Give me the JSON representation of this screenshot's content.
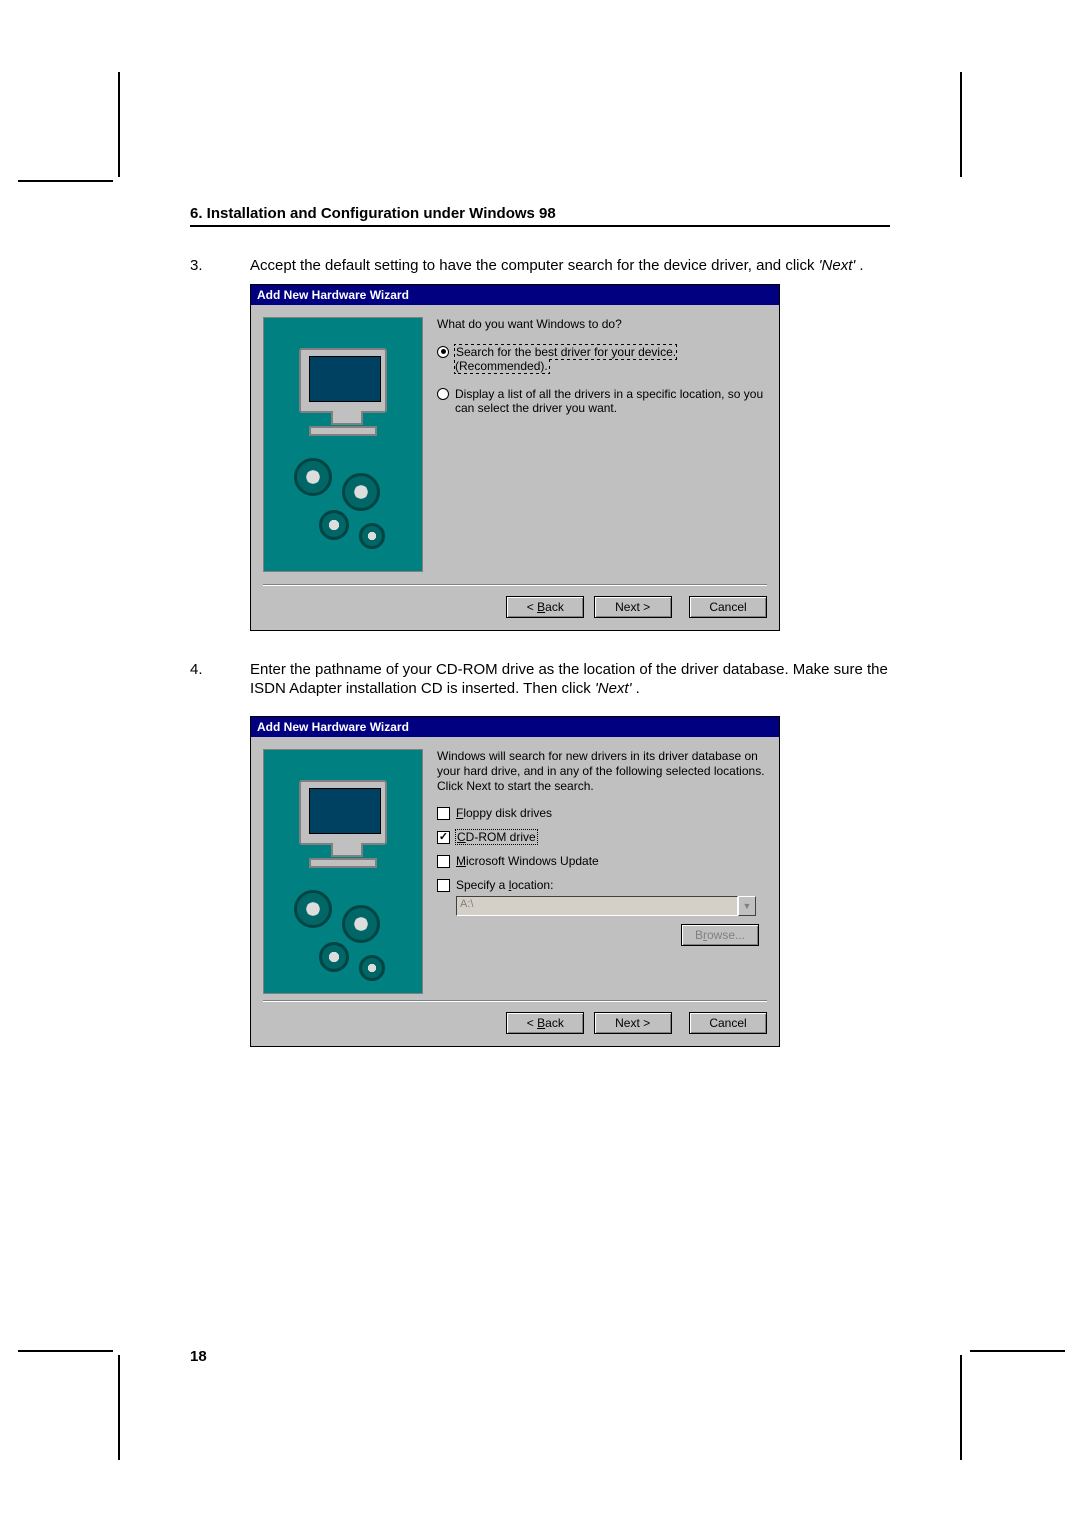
{
  "header": "6. Installation and Configuration under Windows 98",
  "step3": {
    "num": "3.",
    "text_a": "Accept the default setting to have the computer search for the device driver, and click ",
    "text_b": "'Next'",
    "text_c": " ."
  },
  "dialog1": {
    "title": "Add New Hardware Wizard",
    "prompt": "What do you want Windows to do?",
    "opt1": "Search for the best driver for your device. (Recommended).",
    "opt2": "Display a list of all the drivers in a specific location, so you can select the driver you want.",
    "back": "< Back",
    "next": "Next >",
    "cancel": "Cancel"
  },
  "step4": {
    "num": "4.",
    "text_a": "Enter the pathname of your CD-ROM drive as the location of the driver database. Make sure the ISDN Adapter installation CD is inserted. Then click ",
    "text_b": "'Next'",
    "text_c": " ."
  },
  "dialog2": {
    "title": "Add New Hardware Wizard",
    "intro": "Windows will search for new drivers in its driver database on your hard drive, and in any of the following selected locations. Click Next to start the search.",
    "floppy": "Floppy disk drives",
    "cdrom": "CD-ROM drive",
    "update": "Microsoft Windows Update",
    "specify": "Specify a location:",
    "path": "A:\\",
    "browse": "Browse...",
    "back": "< Back",
    "next": "Next >",
    "cancel": "Cancel"
  },
  "page_number": "18"
}
